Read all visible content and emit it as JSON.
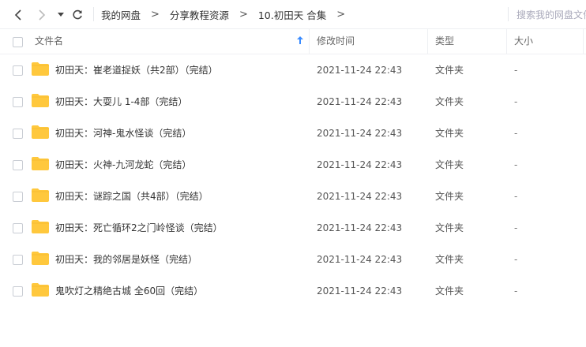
{
  "toolbar": {
    "breadcrumb": [
      "我的网盘",
      "分享教程资源",
      "10.初田天 合集"
    ],
    "search_placeholder": "搜索我的网盘文件"
  },
  "columns": {
    "name": "文件名",
    "modified": "修改时间",
    "type": "类型",
    "size": "大小"
  },
  "files": [
    {
      "name": "初田天：崔老道捉妖（共2部）（完结）",
      "modified": "2021-11-24 22:43",
      "type": "文件夹",
      "size": "-"
    },
    {
      "name": "初田天：大耍儿 1-4部（完结）",
      "modified": "2021-11-24 22:43",
      "type": "文件夹",
      "size": "-"
    },
    {
      "name": "初田天：河神-鬼水怪谈（完结）",
      "modified": "2021-11-24 22:43",
      "type": "文件夹",
      "size": "-"
    },
    {
      "name": "初田天：火神-九河龙蛇（完结）",
      "modified": "2021-11-24 22:43",
      "type": "文件夹",
      "size": "-"
    },
    {
      "name": "初田天：谜踪之国（共4部）（完结）",
      "modified": "2021-11-24 22:43",
      "type": "文件夹",
      "size": "-"
    },
    {
      "name": "初田天：死亡循环2之门岭怪谈（完结）",
      "modified": "2021-11-24 22:43",
      "type": "文件夹",
      "size": "-"
    },
    {
      "name": "初田天：我的邻居是妖怪（完结）",
      "modified": "2021-11-24 22:43",
      "type": "文件夹",
      "size": "-"
    },
    {
      "name": "鬼吹灯之精绝古城  全60回（完结）",
      "modified": "2021-11-24 22:43",
      "type": "文件夹",
      "size": "-"
    }
  ],
  "colors": {
    "folder": "#ffc83d",
    "folder_tab": "#f5b82e",
    "sort_arrow": "#3b8cff"
  }
}
